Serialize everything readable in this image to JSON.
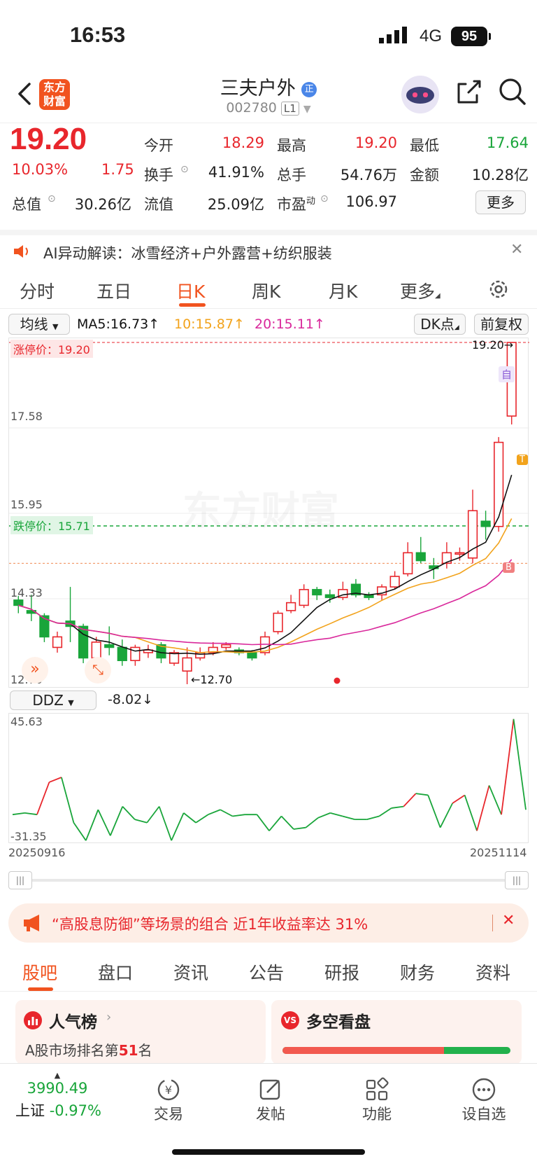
{
  "status_bar": {
    "time": "16:53",
    "network": "4G",
    "battery": "95"
  },
  "header": {
    "logo_text": "东方\n财富",
    "stock_name": "三夫户外",
    "stock_badge": "正",
    "stock_code": "002780",
    "level": "L1"
  },
  "quote": {
    "price": "19.20",
    "change_pct": "10.03%",
    "change": "1.75",
    "open_label": "今开",
    "open": "18.29",
    "high_label": "最高",
    "high": "19.20",
    "low_label": "最低",
    "low": "17.64",
    "turnover_label": "换手",
    "turnover": "41.91%",
    "volume_label": "总手",
    "volume": "54.76万",
    "amount_label": "金额",
    "amount": "10.28亿",
    "mcap_label": "总值",
    "mcap": "30.26亿",
    "float_label": "流值",
    "float_cap": "25.09亿",
    "pe_label": "市盈",
    "pe_sup": "动",
    "pe": "106.97",
    "more_label": "更多"
  },
  "ai_banner": {
    "label": "AI异动解读：冰雪经济+户外露营+纺织服装"
  },
  "tabs": [
    "分时",
    "五日",
    "日K",
    "周K",
    "月K",
    "更多"
  ],
  "active_tab": "日K",
  "ma_bar": {
    "selector": "均线",
    "ma5": "MA5:16.73↑",
    "ma10": "10:15.87↑",
    "ma20": "20:15.11↑",
    "dk": "DK点",
    "adjust": "前复权"
  },
  "kline": {
    "limit_up_label": "涨停价：19.20",
    "limit_down_label": "跌停价：15.71",
    "y_labels": [
      "19.20",
      "17.58",
      "15.95",
      "14.33",
      "12.70"
    ],
    "high_marker": "19.20→",
    "low_marker": "←12.70",
    "watermark": "东方财富",
    "tag_self": "自",
    "tag_t": "T",
    "tag_b": "B"
  },
  "ddz": {
    "selector": "DDZ",
    "value": "-8.02↓",
    "max": "45.63",
    "min": "-31.35",
    "date_start": "20250916",
    "date_end": "20251114"
  },
  "promo": {
    "text": "“高股息防御”等场景的组合 近1年收益率达 31%"
  },
  "bottom_tabs": [
    "股吧",
    "盘口",
    "资讯",
    "公告",
    "研报",
    "财务",
    "资料"
  ],
  "cards": {
    "popularity": {
      "title": "人气榜",
      "rank_text": "A股市场排名第",
      "rank": "51",
      "rank_suffix": "名"
    },
    "bullbear": {
      "title": "多空看盘",
      "bull_ratio": 0.71
    }
  },
  "nav": {
    "index_value": "3990.49",
    "index_name": "上证",
    "index_change": "-0.97%",
    "items": [
      "交易",
      "发帖",
      "功能",
      "设自选"
    ]
  },
  "colors": {
    "up": "#e8262c",
    "down": "#19a53a",
    "ma5": "#111111",
    "ma10": "#f2a31c",
    "ma20": "#d9289b",
    "accent": "#f1531f"
  },
  "chart_data": {
    "type": "candlestick",
    "y_range": [
      12.7,
      19.2
    ],
    "candles": [
      [
        14.3,
        14.2,
        14.38,
        14.05
      ],
      [
        14.1,
        14.05,
        14.4,
        13.9
      ],
      [
        14.0,
        13.6,
        14.05,
        13.5
      ],
      [
        13.4,
        13.6,
        13.7,
        13.3
      ],
      [
        13.9,
        13.8,
        14.55,
        13.5
      ],
      [
        13.8,
        13.2,
        13.85,
        13.1
      ],
      [
        13.2,
        13.5,
        13.6,
        13.0
      ],
      [
        13.45,
        13.4,
        13.8,
        13.25
      ],
      [
        13.4,
        13.15,
        13.55,
        13.05
      ],
      [
        13.15,
        13.4,
        13.45,
        13.05
      ],
      [
        13.3,
        13.35,
        13.45,
        13.2
      ],
      [
        13.45,
        13.2,
        13.5,
        13.1
      ],
      [
        13.1,
        13.3,
        13.35,
        13.05
      ],
      [
        12.95,
        13.2,
        13.4,
        12.7
      ],
      [
        13.2,
        13.3,
        13.4,
        13.15
      ],
      [
        13.3,
        13.4,
        13.5,
        13.25
      ],
      [
        13.4,
        13.45,
        13.5,
        13.35
      ],
      [
        13.35,
        13.3,
        13.4,
        13.25
      ],
      [
        13.3,
        13.2,
        13.35,
        13.15
      ],
      [
        13.3,
        13.6,
        13.7,
        13.25
      ],
      [
        13.7,
        14.05,
        14.1,
        13.65
      ],
      [
        14.1,
        14.25,
        14.4,
        14.05
      ],
      [
        14.2,
        14.5,
        14.6,
        14.15
      ],
      [
        14.5,
        14.4,
        14.55,
        14.3
      ],
      [
        14.4,
        14.35,
        14.5,
        14.25
      ],
      [
        14.35,
        14.5,
        14.65,
        14.3
      ],
      [
        14.6,
        14.4,
        14.7,
        14.35
      ],
      [
        14.4,
        14.35,
        14.45,
        14.3
      ],
      [
        14.4,
        14.55,
        14.6,
        14.3
      ],
      [
        14.55,
        14.75,
        14.85,
        14.5
      ],
      [
        14.8,
        15.2,
        15.4,
        14.75
      ],
      [
        15.2,
        15.05,
        15.5,
        15.0
      ],
      [
        14.95,
        14.9,
        15.1,
        14.7
      ],
      [
        15.0,
        15.2,
        15.4,
        14.9
      ],
      [
        15.2,
        15.2,
        15.3,
        15.05
      ],
      [
        15.1,
        16.0,
        16.4,
        15.0
      ],
      [
        15.8,
        15.7,
        16.0,
        15.45
      ],
      [
        15.7,
        17.3,
        17.4,
        15.6
      ],
      [
        17.8,
        19.2,
        19.2,
        17.64
      ]
    ],
    "ddz_values": [
      -15,
      -14,
      -15,
      5,
      8,
      -20,
      -31,
      -12,
      -28,
      -10,
      -18,
      -20,
      -10,
      -31,
      -14,
      -20,
      -15,
      -12,
      -16,
      -15,
      -15,
      -25,
      -16,
      -24,
      -23,
      -17,
      -14,
      -16,
      -18,
      -18,
      -16,
      -11,
      -10,
      -2,
      -3,
      -23,
      -8,
      -3,
      -25,
      3,
      -15,
      44,
      -12
    ]
  }
}
